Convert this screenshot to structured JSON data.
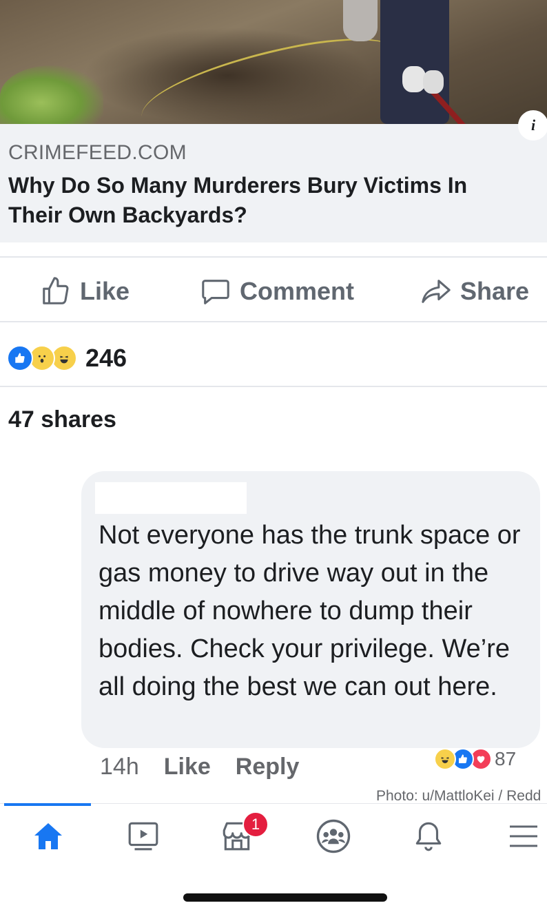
{
  "link_preview": {
    "domain": "CRIMEFEED.COM",
    "title": "Why Do So Many Murderers Bury Victims In\nTheir Own Backyards?",
    "info_icon_glyph": "i"
  },
  "actions": {
    "like_label": "Like",
    "comment_label": "Comment",
    "share_label": "Share"
  },
  "reactions": {
    "icons": [
      "like-reaction-icon",
      "wow-reaction-icon",
      "haha-reaction-icon"
    ],
    "count": "246"
  },
  "shares_text": "47 shares",
  "comment": {
    "author": "",
    "text": "Not everyone has the trunk space or gas money to drive way out in the middle of nowhere to dump their bodies. Check your privilege. We’re all doing the best we can out here.",
    "time": "14h",
    "like_label": "Like",
    "reply_label": "Reply",
    "reaction_icons": [
      "haha-reaction-icon",
      "like-reaction-icon",
      "love-reaction-icon"
    ],
    "reaction_count": "87"
  },
  "photo_credit": "Photo: u/MattloKei / Redd",
  "bottom_nav": {
    "items": [
      "home-icon",
      "watch-icon",
      "marketplace-icon",
      "groups-icon",
      "notifications-icon",
      "menu-icon"
    ],
    "active": "home-icon",
    "marketplace_badge": "1"
  },
  "colors": {
    "accent": "#1877f2",
    "badge": "#e41e3f",
    "muted_text": "#65676b",
    "bubble_bg": "#f0f2f5"
  }
}
